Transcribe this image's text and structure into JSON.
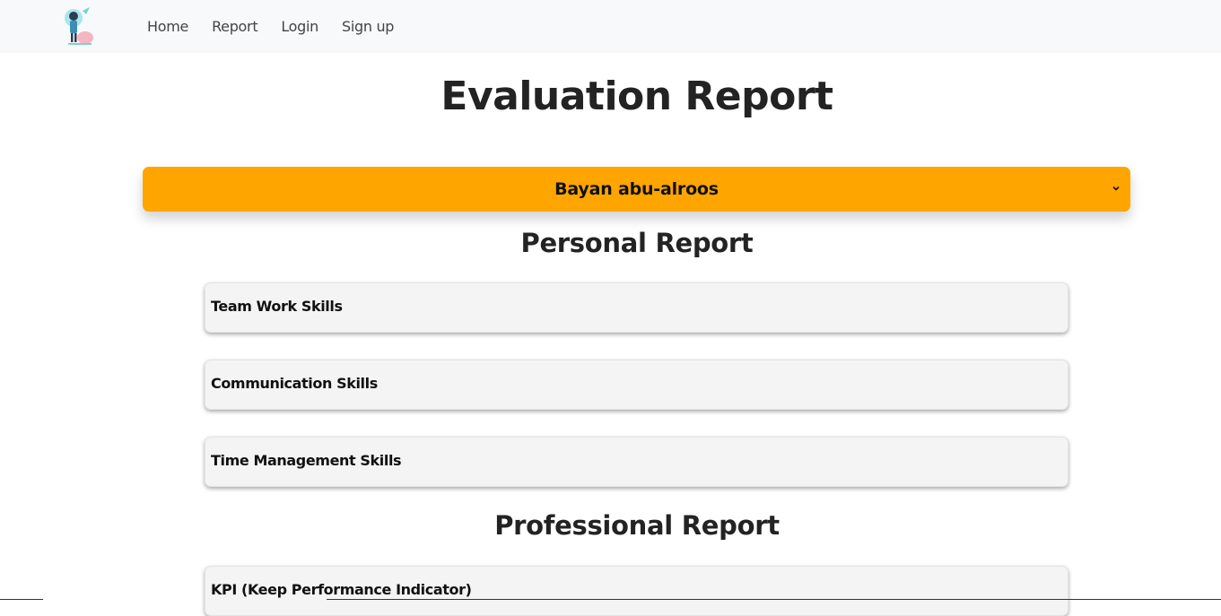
{
  "navbar": {
    "logo_icon": "avatar-logo-icon",
    "links": [
      {
        "label": "Home"
      },
      {
        "label": "Report"
      },
      {
        "label": "Login"
      },
      {
        "label": "Sign up"
      }
    ]
  },
  "main": {
    "title": "Evaluation Report",
    "employee_select": {
      "selected": "Bayan abu-alroos",
      "icon": "chevron-down-icon",
      "color": "#ffa500"
    },
    "personal_section": {
      "title": "Personal Report",
      "items": [
        {
          "label": "Team Work Skills"
        },
        {
          "label": "Communication Skills"
        },
        {
          "label": "Time Management Skills"
        }
      ]
    },
    "professional_section": {
      "title": "Professional Report",
      "items": [
        {
          "label": "KPI (Keep Performance Indicator)"
        }
      ]
    }
  }
}
